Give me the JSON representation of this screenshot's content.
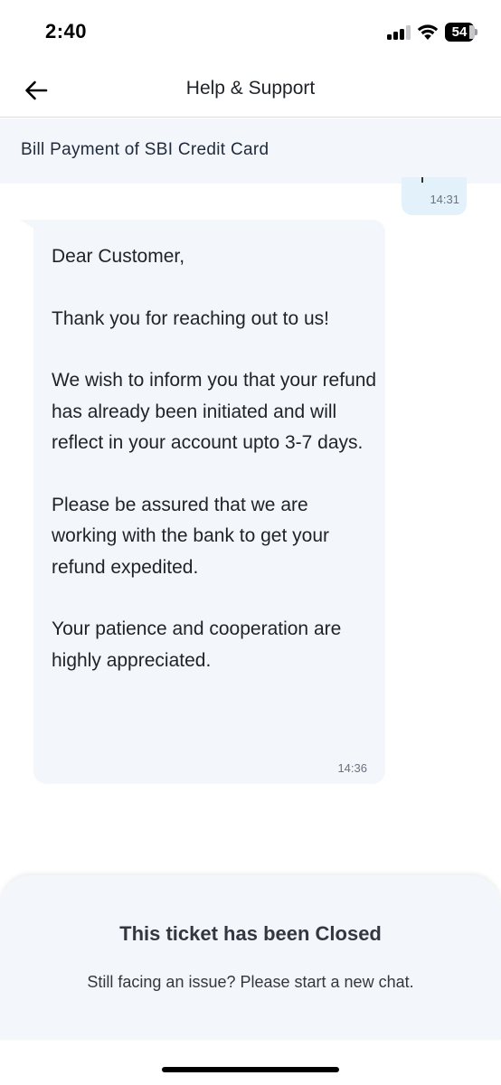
{
  "status_bar": {
    "time": "2:40",
    "battery_level": "54",
    "signal_bars_active": 3,
    "signal_bars_total": 4
  },
  "header": {
    "back_icon": "arrow-left-icon",
    "title": "Help & Support"
  },
  "subject": {
    "text": "Bill Payment of SBI Credit Card"
  },
  "messages": [
    {
      "sender": "user",
      "time": "14:31"
    },
    {
      "sender": "agent",
      "paragraphs": [
        "Dear Customer,",
        "Thank you for reaching out to us!",
        "We wish to inform you that your refund has already been initiated and will reflect in your account upto 3-7 days.",
        "Please be assured that we are working with the bank to get your refund expedited.",
        "Your patience and cooperation are highly appreciated."
      ],
      "time": "14:36"
    }
  ],
  "closed_ticket": {
    "title": "This ticket has been Closed",
    "subtitle": "Still facing an issue? Please start a new chat."
  },
  "colors": {
    "bubble_agent": "#f3f6fa",
    "bubble_user": "#e3f1fb",
    "panel_bg": "#f3f6fa",
    "text_primary": "#1f2328",
    "timestamp": "#6b7280"
  }
}
